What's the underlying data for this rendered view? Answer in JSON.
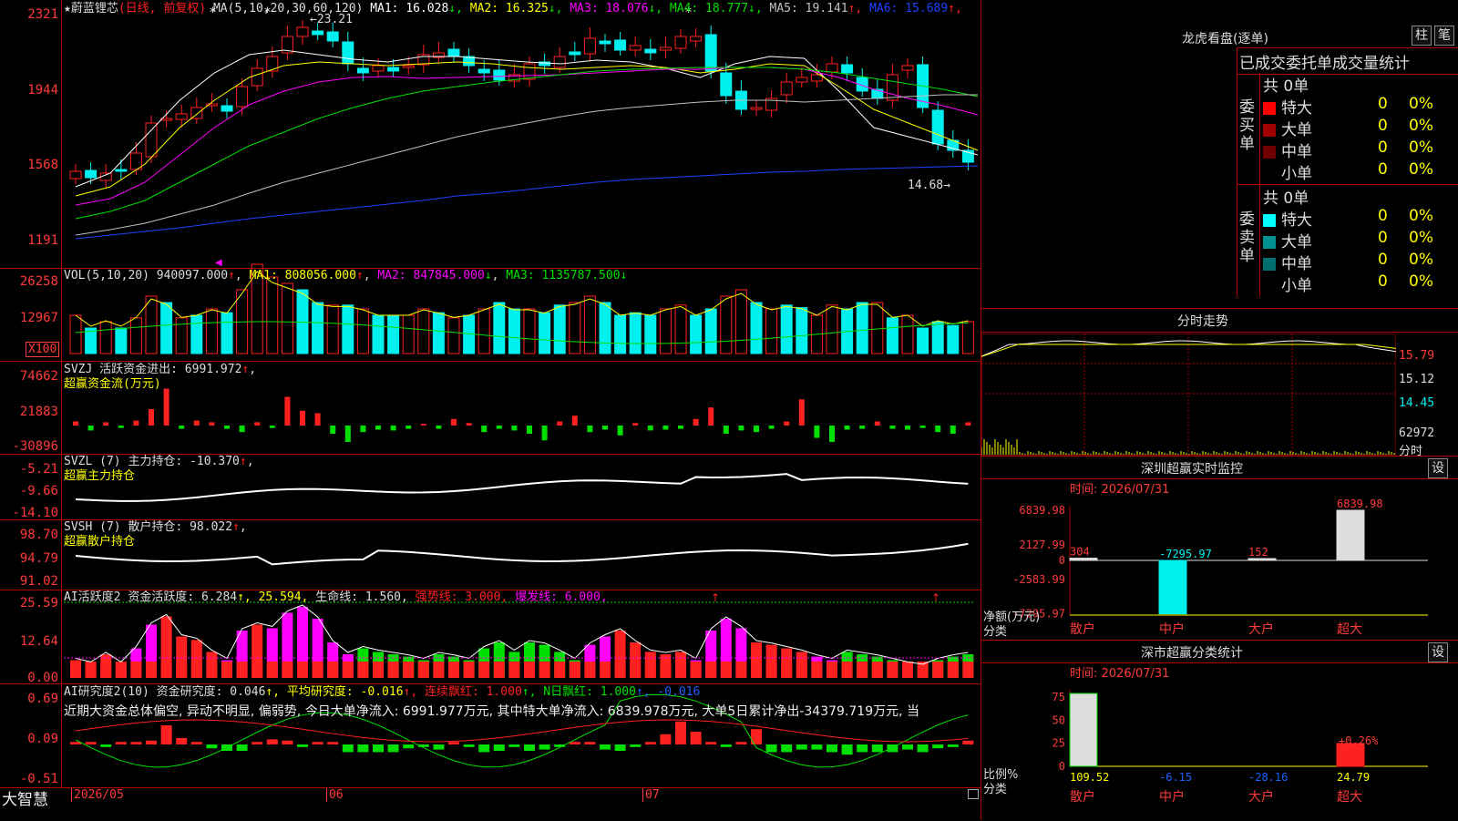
{
  "colors": {
    "up": "#ff2020",
    "down": "#00f0f0",
    "green": "#00e000",
    "grid": "#b00000",
    "yellow": "#ffff00",
    "magenta": "#ff00ff",
    "white": "#ffffff"
  },
  "kline": {
    "title": "蔚蓝锂芯",
    "title_prefix": "★",
    "period": "(日线, 前复权)",
    "ma_label": "MA(5,10,20,30,60,120)",
    "ma": [
      {
        "label": "MA1: 16.028",
        "arrow": "↓",
        "color": "#ffffff"
      },
      {
        "label": "MA2: 16.325",
        "arrow": "↓",
        "color": "#ffff00"
      },
      {
        "label": "MA3: 18.076",
        "arrow": "↓",
        "color": "#ff00ff"
      },
      {
        "label": "MA4: 18.777",
        "arrow": "↓",
        "color": "#00e000"
      },
      {
        "label": "MA5: 19.141",
        "arrow": "↑",
        "color": "#c0c0c0"
      },
      {
        "label": "MA6: 15.689",
        "arrow": "↑",
        "color": "#2040ff"
      }
    ],
    "y_labels": [
      "2321",
      "1944",
      "1568",
      "1191"
    ],
    "high_mark": "23.21",
    "low_mark": "14.68"
  },
  "vol": {
    "label": "VOL(5,10,20)",
    "value": "940097.000",
    "ma1": "MA1: 808056.000",
    "ma2": "MA2: 847845.000",
    "ma3": "MA3: 1135787.500",
    "y_labels": [
      "26258",
      "12967"
    ],
    "unit": "X100"
  },
  "svzj": {
    "label": "SVZJ  活跃资金进出: 6991.972",
    "sub": "超赢资金流(万元)",
    "y_labels": [
      "74662",
      "21883",
      "-30896"
    ]
  },
  "svzl": {
    "label": "SVZL (7) 主力持仓: -10.370",
    "sub": "超赢主力持仓",
    "y_labels": [
      "-5.21",
      "-9.66",
      "-14.10"
    ]
  },
  "svsh": {
    "label": "SVSH (7) 散户持仓: 98.022",
    "sub": "超赢散户持仓",
    "y_labels": [
      "98.70",
      "94.79",
      "91.02"
    ]
  },
  "ai1": {
    "label": "AI活跃度2",
    "parts": [
      {
        "t": "资金活跃度: 6.284",
        "c": "#dddddd"
      },
      {
        "t": "↑, 25.594, ",
        "c": "#ffff00"
      },
      {
        "t": "生命线: 1.560, ",
        "c": "#dddddd"
      },
      {
        "t": "强势线: 3.000, ",
        "c": "#ff2020"
      },
      {
        "t": "爆发线: 6.000,",
        "c": "#ff00ff"
      }
    ],
    "y_labels": [
      "25.59",
      "12.64",
      "0.00"
    ]
  },
  "ai2": {
    "label": "AI研究度2(10)",
    "parts": [
      {
        "t": "资金研究度: 0.046",
        "c": "#dddddd"
      },
      {
        "t": "↑, 平均研究度: -0.016",
        "c": "#ffff00"
      },
      {
        "t": "↑, 连续飘红: 1.000",
        "c": "#ff2020"
      },
      {
        "t": "↑, N日飘红: 1.000",
        "c": "#00e000"
      },
      {
        "t": "↑, -0.016",
        "c": "#2060ff"
      }
    ],
    "y_labels": [
      "0.69",
      "0.09",
      "-0.51"
    ],
    "commentary": "近期大资金总体偏空, 异动不明显, 偏弱势, 今日大单净流入: 6991.977万元, 其中特大单净流入: 6839.978万元, 大单5日累计净出-34379.719万元, 当"
  },
  "bottom": {
    "brand": "大智慧",
    "dates": [
      "2026/05",
      "06",
      "07"
    ]
  },
  "dragon": {
    "title": "龙虎看盘(逐单)",
    "btn1": "柱",
    "btn2": "笔",
    "header": "已成交委托单成交量统计",
    "buy_label": "委买单",
    "sell_label": "委卖单",
    "buy_total": "共 0单",
    "sell_total": "共 0单",
    "buy_rows": [
      {
        "name": "特大",
        "v": "0",
        "p": "0%",
        "c": "#ff0000"
      },
      {
        "name": "大单",
        "v": "0",
        "p": "0%",
        "c": "#a00000"
      },
      {
        "name": "中单",
        "v": "0",
        "p": "0%",
        "c": "#700000"
      },
      {
        "name": "小单",
        "v": "0",
        "p": "0%",
        "c": "#000000"
      }
    ],
    "sell_rows": [
      {
        "name": "特大",
        "v": "0",
        "p": "0%",
        "c": "#00ffff"
      },
      {
        "name": "大单",
        "v": "0",
        "p": "0%",
        "c": "#009090"
      },
      {
        "name": "中单",
        "v": "0",
        "p": "0%",
        "c": "#007070"
      },
      {
        "name": "小单",
        "v": "0",
        "p": "0%",
        "c": "#000000"
      }
    ]
  },
  "intraday": {
    "title": "分时走势",
    "prices": [
      "15.79",
      "15.12",
      "14.45"
    ],
    "vol": "62972",
    "unit": "分时"
  },
  "monitor": {
    "title": "深圳超赢实时监控",
    "btn": "设",
    "time": "时间: 2026/07/31",
    "y_labels": [
      "6839.98",
      "2127.99",
      "0",
      "-2583.99",
      "-7295.97"
    ],
    "axis_title": "净额(万元)",
    "cat_title": "分类",
    "categories": [
      "散户",
      "中户",
      "大户",
      "超大"
    ]
  },
  "chart_data": [
    {
      "type": "bar",
      "title": "深圳超赢实时监控",
      "categories": [
        "散户",
        "中户",
        "大户",
        "超大"
      ],
      "values": [
        304,
        -7295.97,
        152,
        6839.98
      ],
      "ylim": [
        -7295.97,
        6839.98
      ],
      "ylabel": "净额(万元)",
      "value_labels": [
        "304",
        "-7295.97",
        "152",
        "6839.98"
      ]
    },
    {
      "type": "bar",
      "title": "深市超赢分类统计",
      "categories": [
        "散户",
        "中户",
        "大户",
        "超大"
      ],
      "values": [
        109.52,
        -6.15,
        -28.16,
        24.79
      ],
      "ylabel": "比例%",
      "y_ticks": [
        "75",
        "50",
        "25",
        "0"
      ],
      "annotation": "+0.26%"
    }
  ],
  "classify": {
    "title": "深市超赢分类统计",
    "btn": "设",
    "time": "时间: 2026/07/31",
    "axis_title": "比例%",
    "cat_title": "分类",
    "y_labels": [
      "75",
      "50",
      "25",
      "0"
    ],
    "categories": [
      "散户",
      "中户",
      "大户",
      "超大"
    ],
    "values": [
      "109.52",
      "-6.15",
      "-28.16",
      "24.79"
    ],
    "annot": "+0.26%"
  }
}
